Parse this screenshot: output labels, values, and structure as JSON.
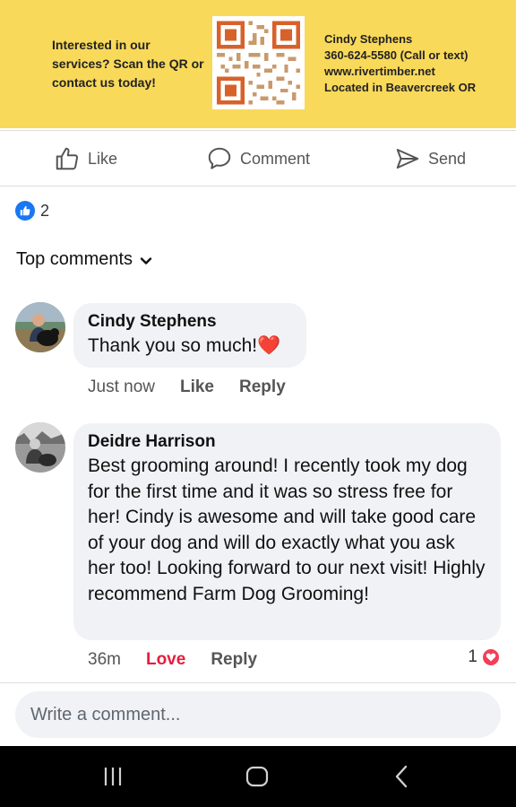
{
  "banner": {
    "left_text": "Interested in our services? Scan the QR or contact us today!",
    "contact_lines": [
      "Cindy Stephens",
      "360-624-5580 (Call or text)",
      "www.rivertimber.net",
      "Located in Beavercreek OR"
    ],
    "accent_color": "#f9d95a"
  },
  "actions": {
    "like": "Like",
    "comment": "Comment",
    "send": "Send"
  },
  "reactions": {
    "count": "2"
  },
  "top_comments_label": "Top comments",
  "comments": [
    {
      "author": "Cindy Stephens",
      "text": "Thank you so much!❤️",
      "time": "Just now",
      "like_label": "Like",
      "reply_label": "Reply"
    },
    {
      "author": "Deidre Harrison",
      "text": "Best grooming around! I recently took my dog for the first time and it was so stress free for her! Cindy is awesome and will take good care of your dog and will do exactly what you ask her too! Looking forward to our next visit! Highly recommend Farm Dog Grooming!",
      "time": "36m",
      "like_label": "Love",
      "reply_label": "Reply",
      "reaction_count": "1"
    }
  ],
  "composer": {
    "placeholder": "Write a comment..."
  },
  "icons": [
    "thumbs-up-icon",
    "comment-icon",
    "send-icon",
    "chevron-down-icon",
    "heart-icon",
    "qr-code",
    "nav-recents-icon",
    "nav-home-icon",
    "nav-back-icon"
  ]
}
